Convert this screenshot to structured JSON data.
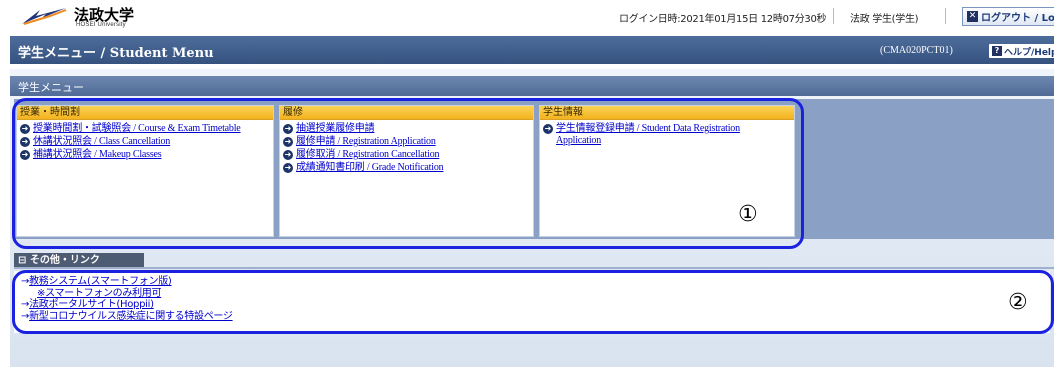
{
  "header": {
    "logo_text": "法政大学",
    "logo_sub": "HOSEI University",
    "login_info": "ログイン日時:2021年01月15日 12時07分30秒",
    "user_name": "法政 学生(学生)",
    "logout_label": "ログアウト / Log out",
    "logout_icon": "x-icon"
  },
  "titlebar": {
    "title": "学生メニュー / Student Menu",
    "screen_code": "(CMA020PCT01)",
    "help_label": "ヘルプ/Help",
    "help_icon": "question-icon"
  },
  "menu": {
    "header": "学生メニュー",
    "columns": [
      {
        "title": "授業・時間割",
        "links": [
          "授業時間割・試験照会 / Course & Exam Timetable",
          "休講状況照会 / Class Cancellation",
          "補講状況照会 / Makeup Classes"
        ]
      },
      {
        "title": "履修",
        "links": [
          "抽選授業履修申請",
          "履修申請 / Registration Application",
          "履修取消 / Registration Cancellation",
          "成績通知書印刷 / Grade Notification"
        ]
      },
      {
        "title": "学生情報",
        "links": [
          "学生情報登録申請 / Student Data Registration Application"
        ]
      }
    ],
    "annotation": "①"
  },
  "other": {
    "header": "その他・リンク",
    "links": [
      {
        "text": "教務システム(スマートフォン版)",
        "note": "※スマートフォンのみ利用可"
      },
      {
        "text": "法政ポータルサイト(Hoppii)"
      },
      {
        "text": "新型コロナウイルス感染症に関する特設ページ"
      }
    ],
    "annotation": "②"
  },
  "colors": {
    "title_bar": "#3f5e8d",
    "column_header": "#f5bb2a",
    "link": "#0000cc",
    "highlight": "#1a22e0"
  }
}
